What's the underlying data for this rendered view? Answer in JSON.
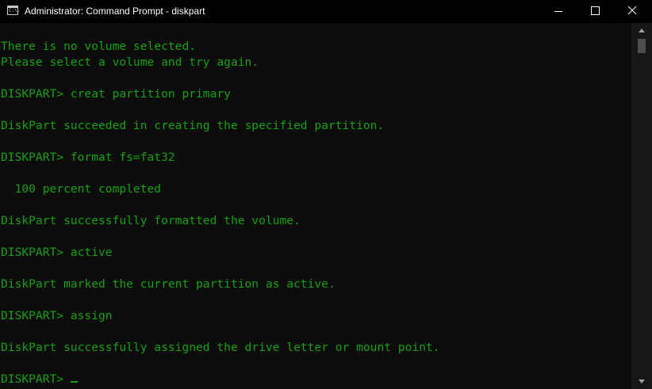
{
  "window": {
    "title": "Administrator: Command Prompt - diskpart",
    "icon": "cmd-icon",
    "icon_text": "C:\\."
  },
  "colors": {
    "console_bg": "#0c0c0c",
    "console_text": "#13a10e",
    "titlebar_bg": "#000000",
    "scrollbar_bg": "#171717",
    "scroll_thumb": "#4d4d4d"
  },
  "console": {
    "lines": [
      "",
      "There is no volume selected.",
      "Please select a volume and try again.",
      "",
      "DISKPART> creat partition primary",
      "",
      "DiskPart succeeded in creating the specified partition.",
      "",
      "DISKPART> format fs=fat32",
      "",
      "  100 percent completed",
      "",
      "DiskPart successfully formatted the volume.",
      "",
      "DISKPART> active",
      "",
      "DiskPart marked the current partition as active.",
      "",
      "DISKPART> assign",
      "",
      "DiskPart successfully assigned the drive letter or mount point.",
      "",
      "DISKPART> "
    ]
  }
}
